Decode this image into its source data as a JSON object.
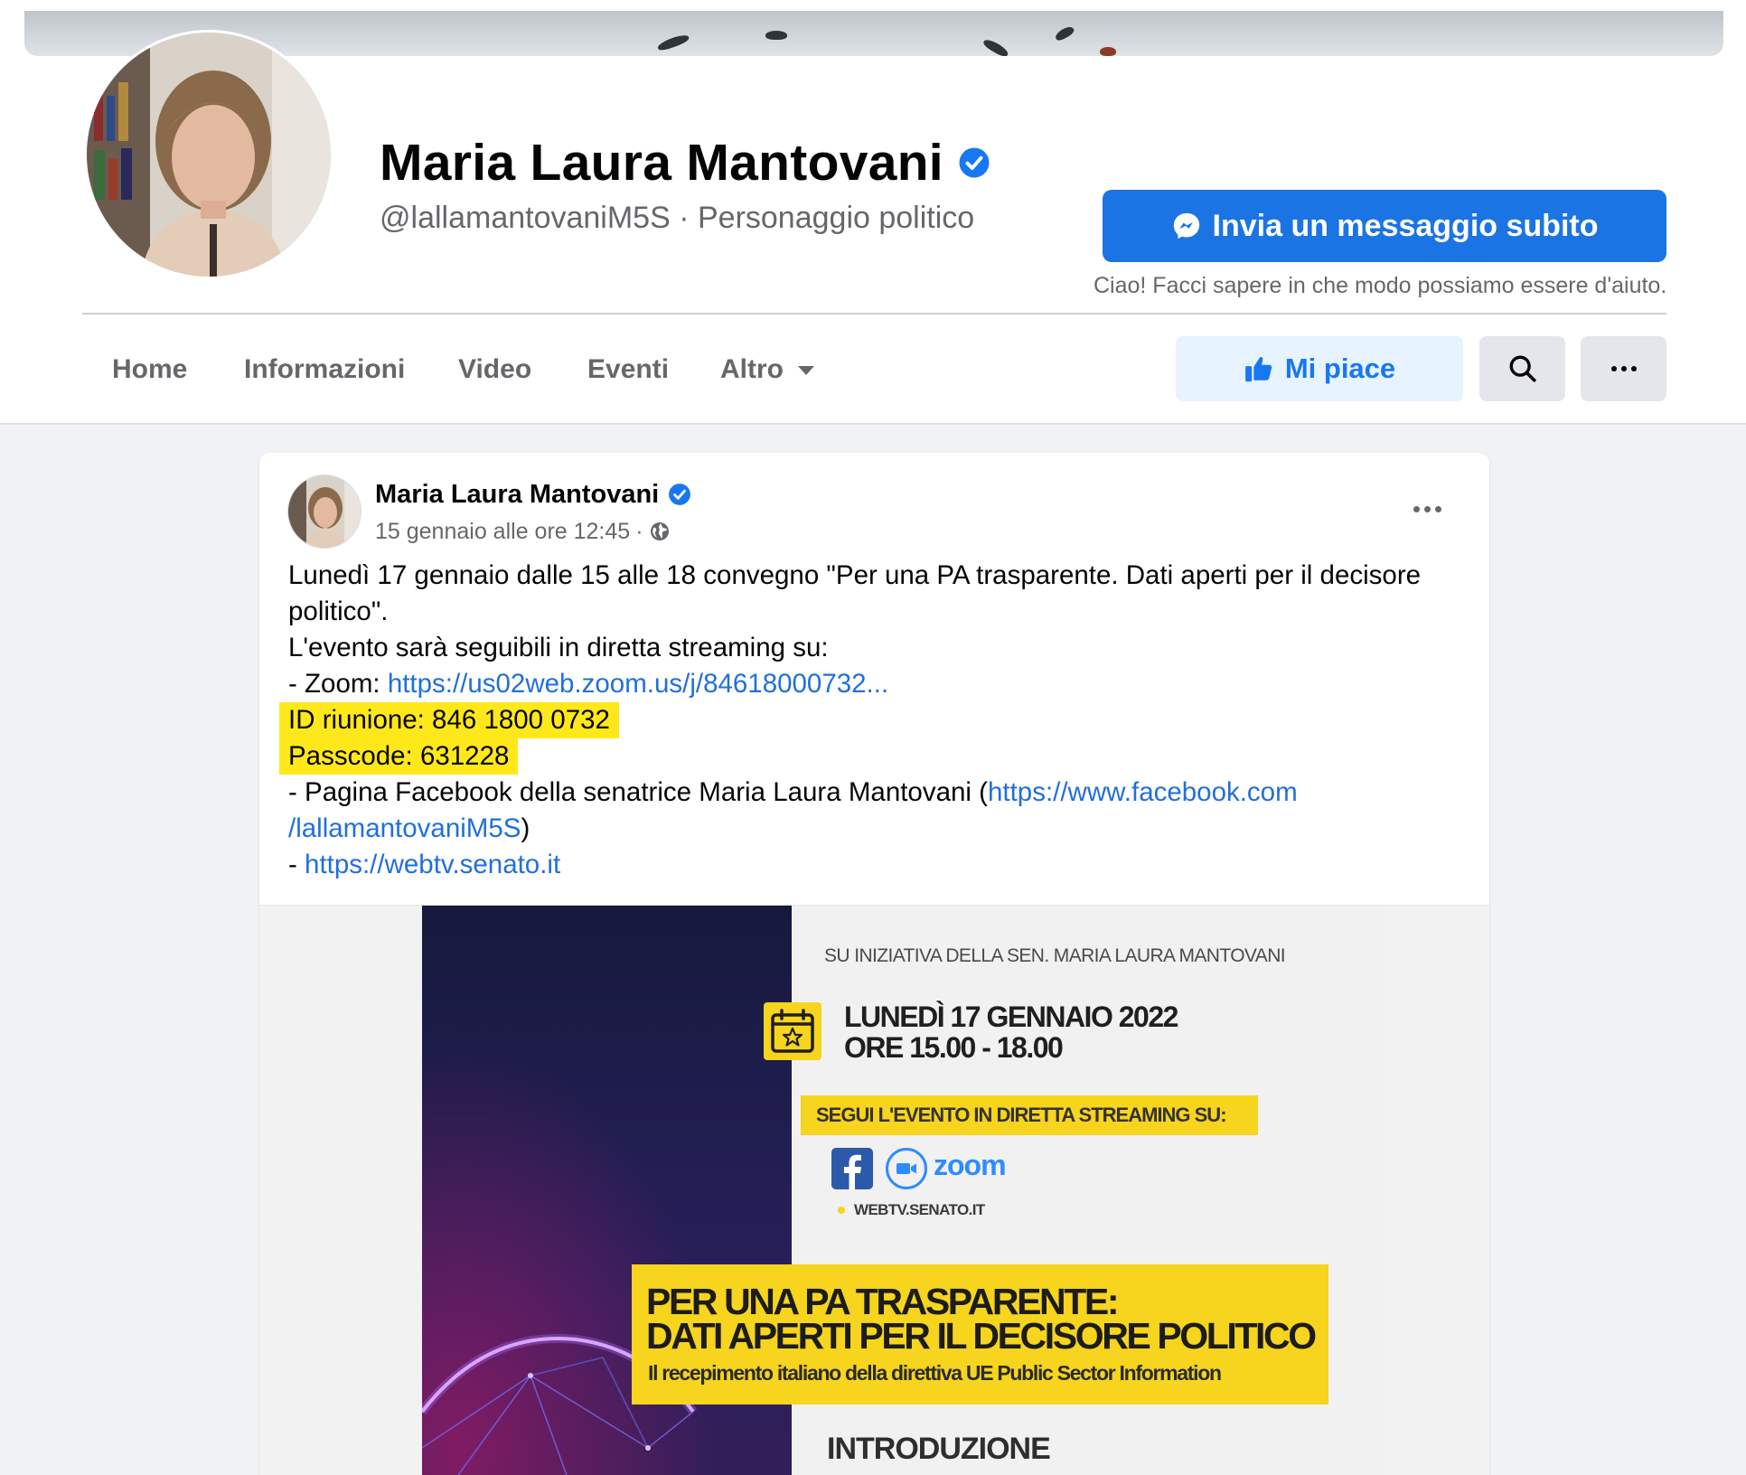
{
  "profile": {
    "name": "Maria Laura Mantovani",
    "handle_category": "@lallamantovaniM5S · Personaggio politico",
    "message_button_label": "Invia un messaggio subito",
    "message_hint": "Ciao! Facci sapere in che modo possiamo essere d'aiuto."
  },
  "nav": {
    "tabs": [
      "Home",
      "Informazioni",
      "Video",
      "Eventi",
      "Altro"
    ],
    "like_label": "Mi piace"
  },
  "post": {
    "author": "Maria Laura Mantovani",
    "date": "15 gennaio alle ore 12:45",
    "meta_sep": "·",
    "text": {
      "line1": "Lunedì 17 gennaio dalle 15 alle 18 convegno \"Per una PA trasparente. Dati aperti per il decisore",
      "line2": "politico\".",
      "line3": "L'evento sarà seguibili in diretta streaming su:",
      "zoom_prefix": "- Zoom: ",
      "zoom_link": "https://us02web.zoom.us/j/84618000732...",
      "meeting_id": "ID riunione: 846 1800 0732",
      "passcode": "Passcode: 631228",
      "fb_prefix": "- Pagina Facebook della senatrice Maria Laura Mantovani (",
      "fb_link_part1": "https://www.facebook.com",
      "fb_link_part2": "/lallamantovaniM5S",
      "fb_suffix": ")",
      "senato_prefix": "- ",
      "senato_link": "https://webtv.senato.it"
    }
  },
  "flyer": {
    "initiative": "SU INIZIATIVA DELLA SEN. MARIA LAURA MANTOVANI",
    "date": "LUNEDÌ 17 GENNAIO 2022",
    "time": "ORE 15.00 - 18.00",
    "stream": "SEGUI L'EVENTO IN DIRETTA STREAMING SU:",
    "zoom": "zoom",
    "web": "WEBTV.SENATO.IT",
    "title1": "PER UNA PA TRASPARENTE:",
    "title2": "DATI APERTI PER IL DECISORE POLITICO",
    "subtitle": "Il recepimento italiano della direttiva UE Public Sector Information",
    "intro": "INTRODUZIONE"
  },
  "colors": {
    "facebook_blue": "#1b74e4",
    "link_blue": "#216fdb",
    "highlight_yellow": "#ffe81a",
    "flyer_yellow": "#f7d41d",
    "flyer_dark": "#1e1c4a"
  },
  "icons": [
    "verified-badge-icon",
    "messenger-icon",
    "caret-down-icon",
    "thumbs-up-icon",
    "search-icon",
    "more-dots-icon",
    "globe-icon",
    "calendar-icon",
    "facebook-icon",
    "zoom-camera-icon"
  ]
}
